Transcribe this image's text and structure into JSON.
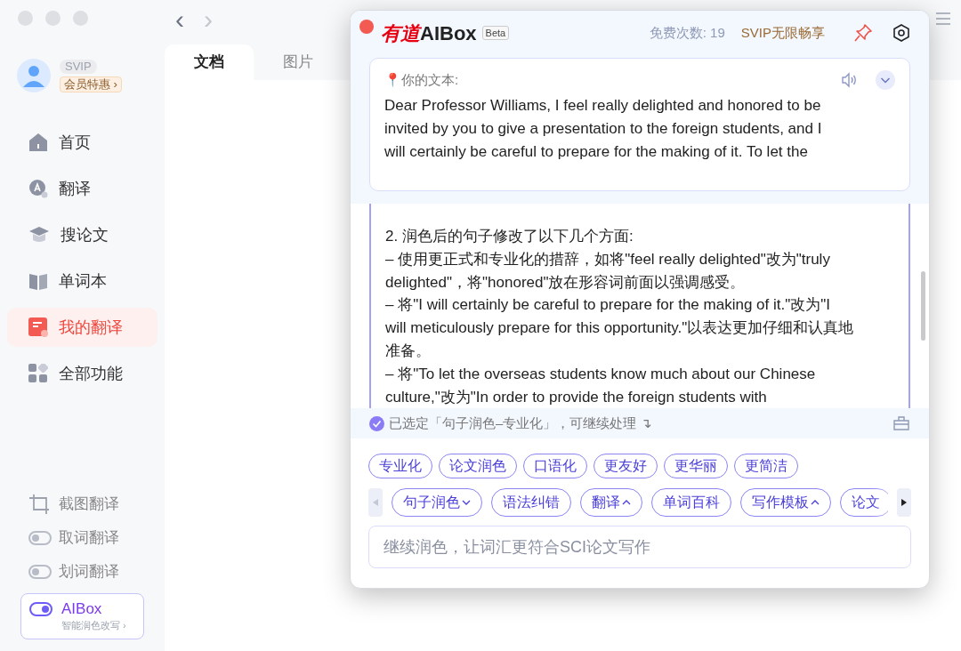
{
  "nav": {
    "back": "‹",
    "forward": "›"
  },
  "user": {
    "badge": "SVIP",
    "promo": "会员特惠 ›"
  },
  "sidebar": {
    "items": [
      {
        "label": "首页",
        "selected": false
      },
      {
        "label": "翻译",
        "selected": false
      },
      {
        "label": "搜论文",
        "selected": false
      },
      {
        "label": "单词本",
        "selected": false
      },
      {
        "label": "我的翻译",
        "selected": true
      },
      {
        "label": "全部功能",
        "selected": false
      }
    ],
    "tools": [
      {
        "label": "截图翻译",
        "kind": "crop"
      },
      {
        "label": "取词翻译",
        "kind": "toggle",
        "on": false
      },
      {
        "label": "划词翻译",
        "kind": "toggle",
        "on": false
      }
    ],
    "aibox": {
      "title": "AIBox",
      "subtitle": "智能润色改写 ›",
      "on": true
    }
  },
  "tabs": [
    {
      "label": "文档",
      "selected": true
    },
    {
      "label": "图片",
      "selected": false
    }
  ],
  "popup": {
    "brand": "有道",
    "title": "AIBox",
    "beta": "Beta",
    "quota": "免费次数: 19",
    "svip": "SVIP无限畅享",
    "source": {
      "label": "📍你的文本:",
      "lines": [
        "Dear Professor Williams, I feel really delighted and honored to be",
        "invited by you to give a presentation to the foreign students, and I",
        "will certainly be careful to prepare for the making of it. To let the"
      ]
    },
    "result_lines": [
      "2. 润色后的句子修改了以下几个方面:",
      "– 使用更正式和专业化的措辞，如将\"feel really delighted\"改为\"truly",
      "delighted\"，将\"honored\"放在形容词前面以强调感受。",
      "– 将\"I will certainly be careful to prepare for the making of it.\"改为\"I",
      "will meticulously prepare for this opportunity.\"以表达更加仔细和认真地",
      "准备。",
      "– 将\"To let the overseas students know much about our Chinese",
      "culture,\"改为\"In order to provide the foreign students with"
    ],
    "status": "已选定「句子润色–专业化」，可继续处理 ↴",
    "styles": [
      "专业化",
      "论文润色",
      "口语化",
      "更友好",
      "更华丽",
      "更简洁"
    ],
    "functions": [
      {
        "label": "句子润色",
        "kind": "dropdown"
      },
      {
        "label": "语法纠错",
        "kind": "plain"
      },
      {
        "label": "翻译",
        "kind": "dropup"
      },
      {
        "label": "单词百科",
        "kind": "plain"
      },
      {
        "label": "写作模板",
        "kind": "dropup"
      },
      {
        "label": "论文",
        "kind": "plain"
      }
    ],
    "input": {
      "placeholder": "继续润色，让词汇更符合SCI论文写作"
    }
  }
}
